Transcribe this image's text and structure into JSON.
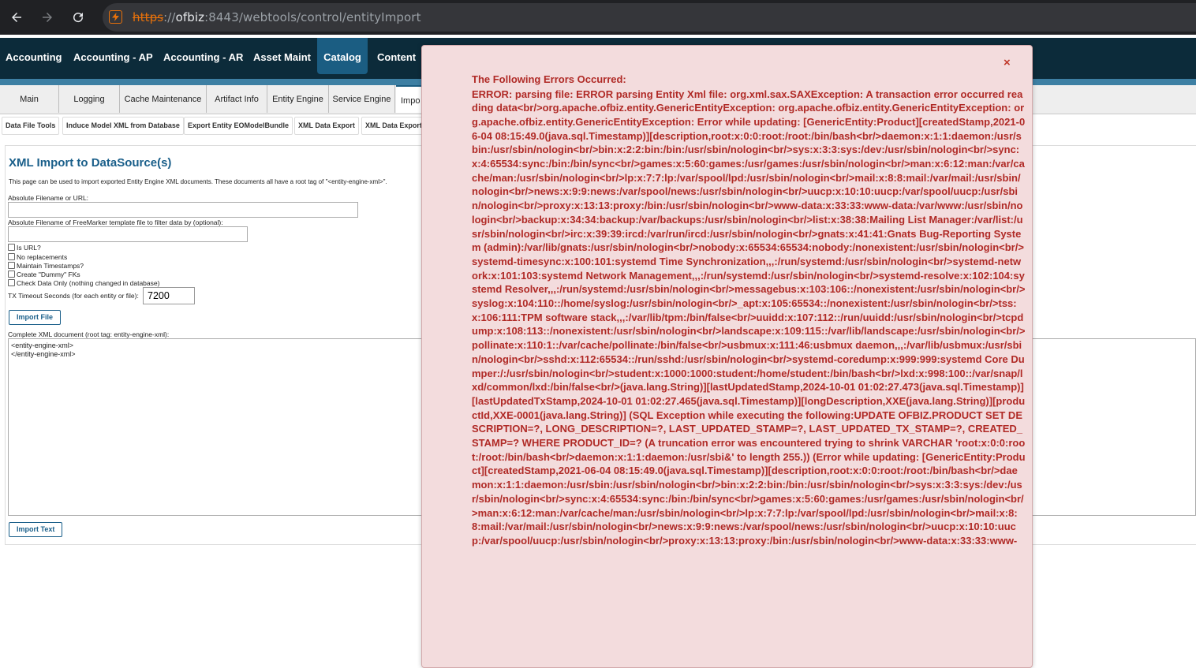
{
  "browser": {
    "url_scheme": "https",
    "url_sep": "://",
    "url_host": "ofbiz",
    "url_rest": ":8443/webtools/control/entityImport",
    "icons": [
      "back-arrow-icon",
      "forward-arrow-icon",
      "reload-icon",
      "site-security-icon"
    ]
  },
  "app_nav": {
    "items": [
      "Accounting",
      "Accounting - AP",
      "Accounting - AR",
      "Asset Maint",
      "Catalog",
      "Content"
    ],
    "active": "Catalog",
    "colors": {
      "bar": "#0c2b3a",
      "active": "#1b5d82",
      "strip": "#3d7fa3"
    }
  },
  "sub_tabs": {
    "items": [
      "Main",
      "Logging",
      "Cache Maintenance",
      "Artifact Info",
      "Entity Engine",
      "Service Engine",
      "Impo"
    ]
  },
  "button_bar": {
    "items": [
      "Data File Tools",
      "Induce Model XML from Database",
      "Export Entity EOModelBundle",
      "XML Data Export",
      "XML Data Export"
    ]
  },
  "form": {
    "title": "XML Import to DataSource(s)",
    "description": "This page can be used to import exported Entity Engine XML documents. These documents all have a root tag of \"<entity-engine-xml>\".",
    "filename_label": "Absolute Filename or URL:",
    "filename_value": "",
    "template_label": "Absolute Filename of FreeMarker template file to filter data by (optional):",
    "template_value": "",
    "checkboxes": [
      {
        "label": "Is URL?",
        "checked": false
      },
      {
        "label": "No replacements",
        "checked": false
      },
      {
        "label": "Maintain Timestamps?",
        "checked": false
      },
      {
        "label": "Create \"Dummy\" FKs",
        "checked": false
      },
      {
        "label": "Check Data Only (nothing changed in database)",
        "checked": false
      }
    ],
    "timeout_label": "TX Timeout Seconds (for each entity or file):",
    "timeout_value": "7200",
    "import_file_button": "Import File",
    "xml_label": "Complete XML document (root tag: entity-engine-xml):",
    "xml_content": "<entity-engine-xml>\n</entity-engine-xml>",
    "import_text_button": "Import Text"
  },
  "error_modal": {
    "close_label": "×",
    "heading": "The Following Errors Occurred:",
    "message": "ERROR: parsing file: ERROR parsing Entity Xml file: org.xml.sax.SAXException: A transaction error occurred reading data<br/>org.apache.ofbiz.entity.GenericEntityException: org.apache.ofbiz.entity.GenericEntityException: org.apache.ofbiz.entity.GenericEntityException: Error while updating: [GenericEntity:Product][createdStamp,2021-06-04 08:15:49.0(java.sql.Timestamp)][description,root:x:0:0:root:/root:/bin/bash<br/>daemon:x:1:1:daemon:/usr/sbin:/usr/sbin/nologin<br/>bin:x:2:2:bin:/bin:/usr/sbin/nologin<br/>sys:x:3:3:sys:/dev:/usr/sbin/nologin<br/>sync:x:4:65534:sync:/bin:/bin/sync<br/>games:x:5:60:games:/usr/games:/usr/sbin/nologin<br/>man:x:6:12:man:/var/cache/man:/usr/sbin/nologin<br/>lp:x:7:7:lp:/var/spool/lpd:/usr/sbin/nologin<br/>mail:x:8:8:mail:/var/mail:/usr/sbin/nologin<br/>news:x:9:9:news:/var/spool/news:/usr/sbin/nologin<br/>uucp:x:10:10:uucp:/var/spool/uucp:/usr/sbin/nologin<br/>proxy:x:13:13:proxy:/bin:/usr/sbin/nologin<br/>www-data:x:33:33:www-data:/var/www:/usr/sbin/nologin<br/>backup:x:34:34:backup:/var/backups:/usr/sbin/nologin<br/>list:x:38:38:Mailing List Manager:/var/list:/usr/sbin/nologin<br/>irc:x:39:39:ircd:/var/run/ircd:/usr/sbin/nologin<br/>gnats:x:41:41:Gnats Bug-Reporting System (admin):/var/lib/gnats:/usr/sbin/nologin<br/>nobody:x:65534:65534:nobody:/nonexistent:/usr/sbin/nologin<br/>systemd-timesync:x:100:101:systemd Time Synchronization,,,:/run/systemd:/usr/sbin/nologin<br/>systemd-network:x:101:103:systemd Network Management,,,:/run/systemd:/usr/sbin/nologin<br/>systemd-resolve:x:102:104:systemd Resolver,,,:/run/systemd:/usr/sbin/nologin<br/>messagebus:x:103:106::/nonexistent:/usr/sbin/nologin<br/>syslog:x:104:110::/home/syslog:/usr/sbin/nologin<br/>_apt:x:105:65534::/nonexistent:/usr/sbin/nologin<br/>tss:x:106:111:TPM software stack,,,:/var/lib/tpm:/bin/false<br/>uuidd:x:107:112::/run/uuidd:/usr/sbin/nologin<br/>tcpdump:x:108:113::/nonexistent:/usr/sbin/nologin<br/>landscape:x:109:115::/var/lib/landscape:/usr/sbin/nologin<br/>pollinate:x:110:1::/var/cache/pollinate:/bin/false<br/>usbmux:x:111:46:usbmux daemon,,,:/var/lib/usbmux:/usr/sbin/nologin<br/>sshd:x:112:65534::/run/sshd:/usr/sbin/nologin<br/>systemd-coredump:x:999:999:systemd Core Dumper:/:/usr/sbin/nologin<br/>student:x:1000:1000:student:/home/student:/bin/bash<br/>lxd:x:998:100::/var/snap/lxd/common/lxd:/bin/false<br/>(java.lang.String)][lastUpdatedStamp,2024-10-01 01:02:27.473(java.sql.Timestamp)][lastUpdatedTxStamp,2024-10-01 01:02:27.465(java.sql.Timestamp)][longDescription,XXE(java.lang.String)][productId,XXE-0001(java.lang.String)] (SQL Exception while executing the following:UPDATE OFBIZ.PRODUCT SET DESCRIPTION=?, LONG_DESCRIPTION=?, LAST_UPDATED_STAMP=?, LAST_UPDATED_TX_STAMP=?, CREATED_STAMP=? WHERE PRODUCT_ID=? (A truncation error was encountered trying to shrink VARCHAR 'root:x:0:0:root:/root:/bin/bash<br/>daemon:x:1:1:daemon:/usr/sbi&' to length 255.)) (Error while updating: [GenericEntity:Product][createdStamp,2021-06-04 08:15:49.0(java.sql.Timestamp)][description,root:x:0:0:root:/root:/bin/bash<br/>daemon:x:1:1:daemon:/usr/sbin:/usr/sbin/nologin<br/>bin:x:2:2:bin:/bin:/usr/sbin/nologin<br/>sys:x:3:3:sys:/dev:/usr/sbin/nologin<br/>sync:x:4:65534:sync:/bin:/bin/sync<br/>games:x:5:60:games:/usr/games:/usr/sbin/nologin<br/>man:x:6:12:man:/var/cache/man:/usr/sbin/nologin<br/>lp:x:7:7:lp:/var/spool/lpd:/usr/sbin/nologin<br/>mail:x:8:8:mail:/var/mail:/usr/sbin/nologin<br/>news:x:9:9:news:/var/spool/news:/usr/sbin/nologin<br/>uucp:x:10:10:uucp:/var/spool/uucp:/usr/sbin/nologin<br/>proxy:x:13:13:proxy:/bin:/usr/sbin/nologin<br/>www-data:x:33:33:www-",
    "colors": {
      "background": "#f3dcdd",
      "text": "#b02a26"
    }
  }
}
